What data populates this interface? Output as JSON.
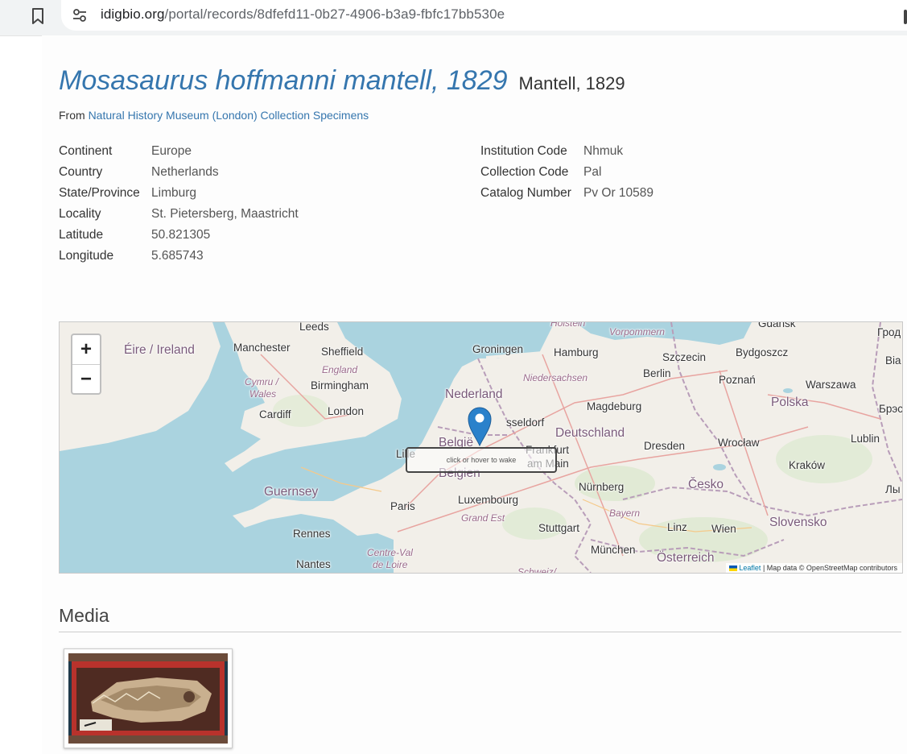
{
  "browser": {
    "url_host": "idigbio.org",
    "url_path": "/portal/records/8dfefd11-0b27-4906-b3a9-fbfc17bb530e",
    "icons": [
      "bookmark-icon",
      "site-settings-icon"
    ]
  },
  "record": {
    "scientific_name": "Mosasaurus hoffmanni mantell, 1829",
    "author": "Mantell, 1829",
    "from_prefix": "From",
    "collection_link": "Natural History Museum (London) Collection Specimens"
  },
  "fields_left": [
    {
      "label": "Continent",
      "value": "Europe"
    },
    {
      "label": "Country",
      "value": "Netherlands"
    },
    {
      "label": "State/Province",
      "value": "Limburg"
    },
    {
      "label": "Locality",
      "value": "St. Pietersberg, Maastricht"
    },
    {
      "label": "Latitude",
      "value": "50.821305"
    },
    {
      "label": "Longitude",
      "value": "5.685743"
    }
  ],
  "fields_right": [
    {
      "label": "Institution Code",
      "value": "Nhmuk"
    },
    {
      "label": "Collection Code",
      "value": "Pal"
    },
    {
      "label": "Catalog Number",
      "value": "Pv Or 10589"
    }
  ],
  "map": {
    "zoom_in": "+",
    "zoom_out": "−",
    "wake_text": "click or hover to wake",
    "attribution_leaflet": "Leaflet",
    "attribution_rest": " | Map data © OpenStreetMap contributors",
    "labels": {
      "leeds": "Leeds",
      "eire": "Éire / Ireland",
      "manchester": "Manchester",
      "sheffield": "Sheffield",
      "england": "England",
      "cymru": "Cymru /",
      "wales": "Wales",
      "birmingham": "Birmingham",
      "cardiff": "Cardiff",
      "london": "London",
      "guernsey": "Guernsey",
      "paris": "Paris",
      "rennes": "Rennes",
      "nantes": "Nantes",
      "centre_val": "Centre-Val",
      "de_loire": "de Loire",
      "lille": "Lille",
      "groningen": "Groningen",
      "nederland": "Nederland",
      "belgie": "België",
      "belgien": "Belgien",
      "luxembourg": "Luxembourg",
      "grand_est": "Grand Est",
      "holstein": "Holstein",
      "vorpommern": "Vorpommern",
      "hamburg": "Hamburg",
      "niedersachsen": "Niedersachsen",
      "dusseldorf": "sseldorf",
      "frankfurt": "Frankfurt",
      "am_main": "am Main",
      "deutschland": "Deutschland",
      "magdeburg": "Magdeburg",
      "berlin": "Berlin",
      "szczecin": "Szczecin",
      "bydgoszcz": "Bydgoszcz",
      "gdansk": "Gdańsk",
      "poznan": "Poznań",
      "warszawa": "Warszawa",
      "polska": "Polska",
      "dresden": "Dresden",
      "wroclaw": "Wrocław",
      "lublin": "Lublin",
      "krakow": "Kraków",
      "nurnberg": "Nürnberg",
      "cesko": "Česko",
      "bayern": "Bayern",
      "stuttgart": "Stuttgart",
      "linz": "Linz",
      "wien": "Wien",
      "slovensko": "Slovensko",
      "munchen": "München",
      "osterreich": "Österreich",
      "schweiz": "Schweiz/",
      "grod": "Грод",
      "bia": "Bia",
      "brest": "Брэс",
      "ly": "Лы"
    }
  },
  "media": {
    "heading": "Media"
  },
  "colors": {
    "link": "#3576ae",
    "water": "#aad3df",
    "land": "#f2efe9",
    "marker": "#2a81cb"
  }
}
